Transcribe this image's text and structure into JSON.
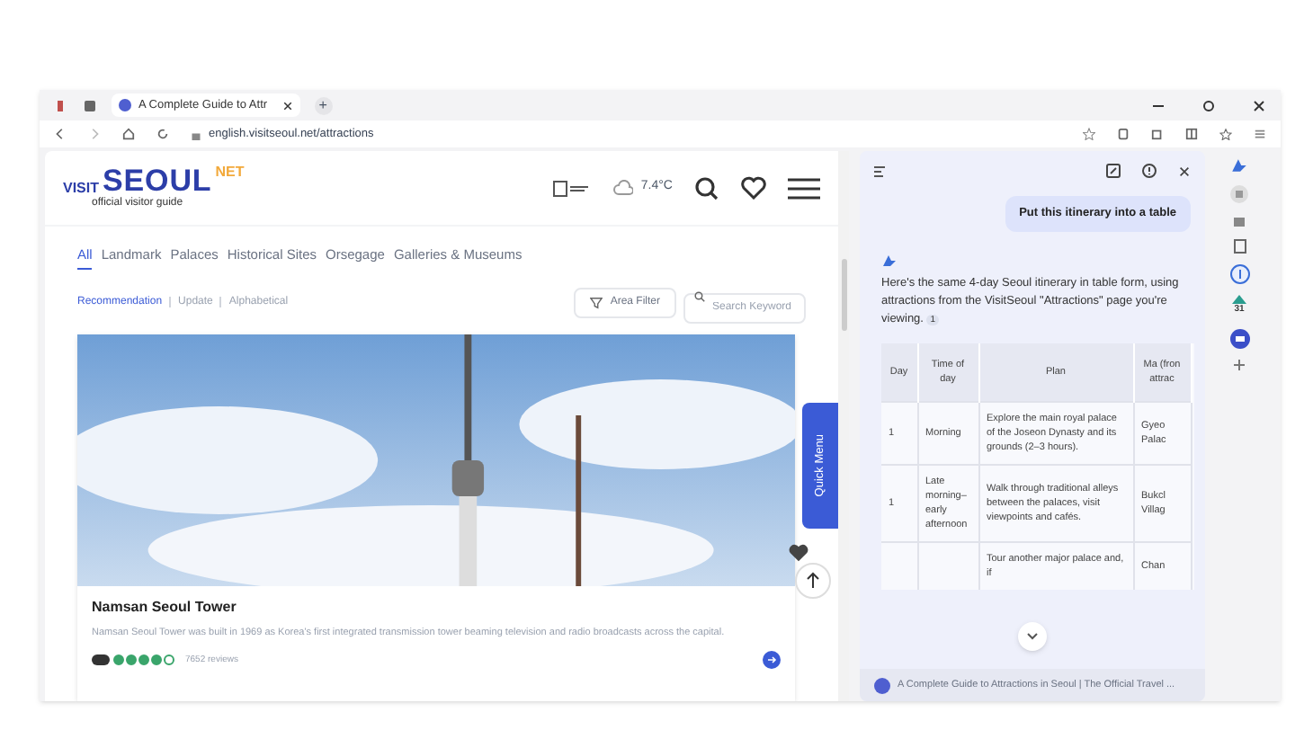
{
  "browser": {
    "tabs": [
      {
        "title": "A Complete Guide to Attr",
        "selected": true
      }
    ],
    "new_tab": "+",
    "address": "english.visitseoul.net/attractions"
  },
  "site": {
    "logo": {
      "visit": "VISIT",
      "seoul": "SEOUL",
      "net": "NET",
      "tagline": "official visitor guide"
    },
    "temperature": "7.4°C",
    "categories": [
      {
        "label": "All",
        "selected": true
      },
      {
        "label": "Landmark",
        "selected": false
      },
      {
        "label": "Palaces",
        "selected": false
      },
      {
        "label": "Historical Sites",
        "selected": false
      },
      {
        "label": "Orsegage",
        "selected": false
      },
      {
        "label": "Galleries & Museums",
        "selected": false
      }
    ],
    "sort": [
      {
        "label": "Recommendation",
        "selected": true
      },
      {
        "label": "Update",
        "selected": false
      },
      {
        "label": "Alphabetical",
        "selected": false
      }
    ],
    "area_filter": "Area Filter",
    "search_placeholder": "Search Keyword",
    "quick_menu": "Quick Menu",
    "card": {
      "title": "Namsan Seoul Tower",
      "description": "Namsan Seoul Tower was built in 1969 as Korea's first integrated transmission tower beaming television and radio broadcasts across the capital.",
      "stars": 4,
      "reviews": "7652 reviews"
    }
  },
  "assistant": {
    "user_message": "Put this itinerary into a table",
    "reply": "Here's the same 4-day Seoul itinerary in table form, using attractions from the VisitSeoul \"Attractions\" page you're viewing.",
    "citation": "1",
    "table": {
      "columns": [
        "Day",
        "Time of day",
        "Plan",
        "Ma (fron attrac"
      ],
      "rows": [
        [
          "1",
          "Morning",
          "Explore the main royal palace of the Joseon Dynasty and its grounds (2–3 hours).",
          "Gyeo Palac"
        ],
        [
          "1",
          "Late morning–early afternoon",
          "Walk through traditional alleys between the palaces, visit viewpoints and cafés.",
          "Bukcl Villag"
        ],
        [
          "",
          "",
          "Tour another major palace and, if",
          "Chan"
        ]
      ]
    },
    "source": "A Complete Guide to Attractions in Seoul | The Official Travel ..."
  },
  "rail_badge": "31"
}
